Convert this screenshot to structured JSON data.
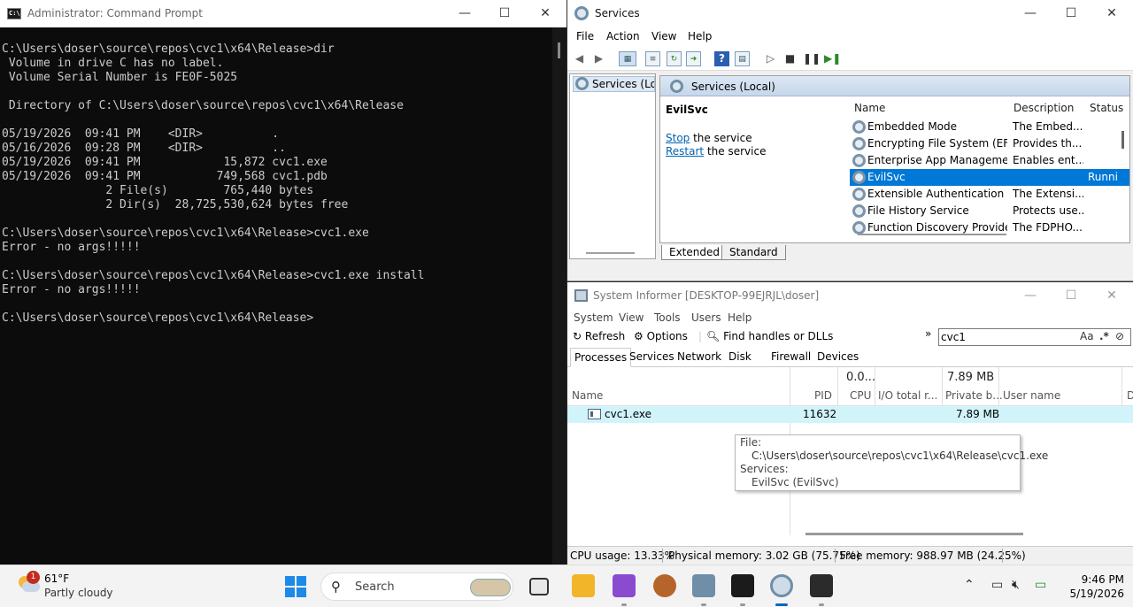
{
  "cmd": {
    "title": "Administrator: Command Prompt",
    "icon_label": "C:\\.",
    "controls": [
      "—",
      "☐",
      "✕"
    ],
    "lines": [
      "C:\\Users\\doser\\source\\repos\\cvc1\\x64\\Release>dir",
      " Volume in drive C has no label.",
      " Volume Serial Number is FE0F-5025",
      "",
      " Directory of C:\\Users\\doser\\source\\repos\\cvc1\\x64\\Release",
      "",
      "05/19/2026  09:41 PM    <DIR>          .",
      "05/16/2026  09:28 PM    <DIR>          ..",
      "05/19/2026  09:41 PM            15,872 cvc1.exe",
      "05/19/2026  09:41 PM           749,568 cvc1.pdb",
      "               2 File(s)        765,440 bytes",
      "               2 Dir(s)  28,725,530,624 bytes free",
      "",
      "C:\\Users\\doser\\source\\repos\\cvc1\\x64\\Release>cvc1.exe",
      "Error - no args!!!!!",
      "",
      "C:\\Users\\doser\\source\\repos\\cvc1\\x64\\Release>cvc1.exe install",
      "Error - no args!!!!!",
      "",
      "C:\\Users\\doser\\source\\repos\\cvc1\\x64\\Release>"
    ]
  },
  "services": {
    "title": "Services",
    "controls": [
      "—",
      "☐",
      "✕"
    ],
    "menu": [
      "File",
      "Action",
      "View",
      "Help"
    ],
    "tree_item": "Services (Local)",
    "pane_title": "Services (Local)",
    "selected_name": "EvilSvc",
    "stop_link": "Stop",
    "stop_rest": " the service",
    "restart_link": "Restart",
    "restart_rest": " the service",
    "columns": {
      "name": "Name",
      "description": "Description",
      "status": "Status",
      "sort_glyph": "˄"
    },
    "rows": [
      {
        "name": "Embedded Mode",
        "description": "The Embed...",
        "status": ""
      },
      {
        "name": "Encrypting File System (EFS)",
        "description": "Provides th...",
        "status": ""
      },
      {
        "name": "Enterprise App Managemen...",
        "description": "Enables ent...",
        "status": ""
      },
      {
        "name": "EvilSvc",
        "description": "",
        "status": "Runni"
      },
      {
        "name": "Extensible Authentication P...",
        "description": "The Extensi...",
        "status": ""
      },
      {
        "name": "File History Service",
        "description": "Protects use...",
        "status": ""
      },
      {
        "name": "Function Discovery Provide...",
        "description": "The FDPHO...",
        "status": ""
      }
    ],
    "tabs": [
      "Extended",
      "Standard"
    ]
  },
  "sysinformer": {
    "title": "System Informer [DESKTOP-99EJRJL\\doser]",
    "controls": [
      "—",
      "☐",
      "✕"
    ],
    "menu": [
      "System",
      "View",
      "Tools",
      "Users",
      "Help"
    ],
    "toolbar": {
      "refresh": "Refresh",
      "options": "Options",
      "find": "Find handles or DLLs",
      "overflow": "»"
    },
    "search": {
      "value": "cvc1",
      "case_opt": "Aa",
      "regex_opt": ".*"
    },
    "tabs": [
      "Processes",
      "Services",
      "Network",
      "Disk",
      "Firewall",
      "Devices"
    ],
    "columns": {
      "name": "Name",
      "pid": "PID",
      "cpu": "CPU",
      "cpu_total": "0.0...",
      "io": "I/O total r...",
      "private": "Private b...",
      "private_total": "7.89 MB",
      "user": "User name",
      "extra": "D"
    },
    "process": {
      "name": "cvc1.exe",
      "pid": "11632",
      "private": "7.89 MB"
    },
    "tooltip": {
      "file_label": "File:",
      "file_path": "C:\\Users\\doser\\source\\repos\\cvc1\\x64\\Release\\cvc1.exe",
      "services_label": "Services:",
      "service": "EvilSvc (EvilSvc)"
    },
    "status": {
      "cpu": "CPU usage: 13.33%",
      "physical": "Physical memory: 3.02 GB (75.75%)",
      "free": "Free memory: 988.97 MB (24.25%)"
    }
  },
  "taskbar": {
    "weather_badge": "1",
    "temp": "61°F",
    "condition": "Partly cloudy",
    "search_label": "Search",
    "time": "9:46 PM",
    "date": "5/19/2026"
  }
}
